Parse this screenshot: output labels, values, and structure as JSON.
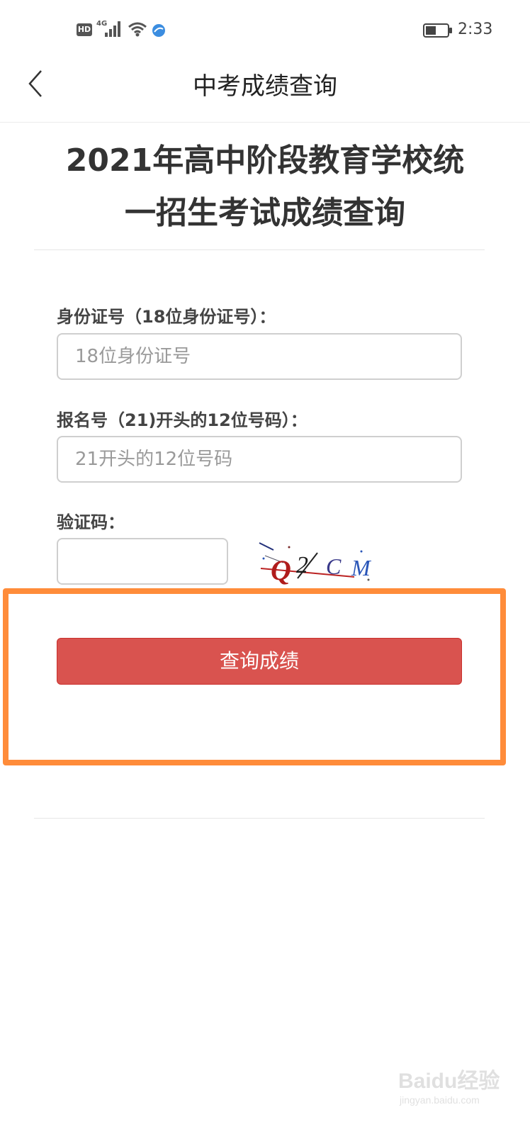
{
  "status_bar": {
    "hd_label": "HD",
    "network_label": "4G",
    "time": "2:33",
    "icons": [
      "hd-icon",
      "signal-icon",
      "wifi-icon",
      "browser-icon",
      "battery-icon"
    ]
  },
  "nav": {
    "back_icon": "chevron-left-icon",
    "title": "中考成绩查询"
  },
  "main": {
    "title_line1": "2021年高中阶段教育学校统",
    "title_line2": "一招生考试成绩查询"
  },
  "form": {
    "id_label": "身份证号（18位身份证号）：",
    "id_placeholder": "18位身份证号",
    "id_value": "",
    "reg_label": "报名号（21)开头的12位号码）：",
    "reg_placeholder": "21开头的12位号码",
    "reg_value": "",
    "captcha_label": "验证码：",
    "captcha_value": "",
    "captcha_text": "Q2CM",
    "submit_label": "查询成绩"
  },
  "watermark": {
    "text": "Baidu经验",
    "url": "jingyan.baidu.com"
  },
  "colors": {
    "submit_bg": "#d9534f",
    "highlight_border": "#ff8c3a",
    "text_main": "#333333",
    "placeholder": "#9a9a9a"
  }
}
